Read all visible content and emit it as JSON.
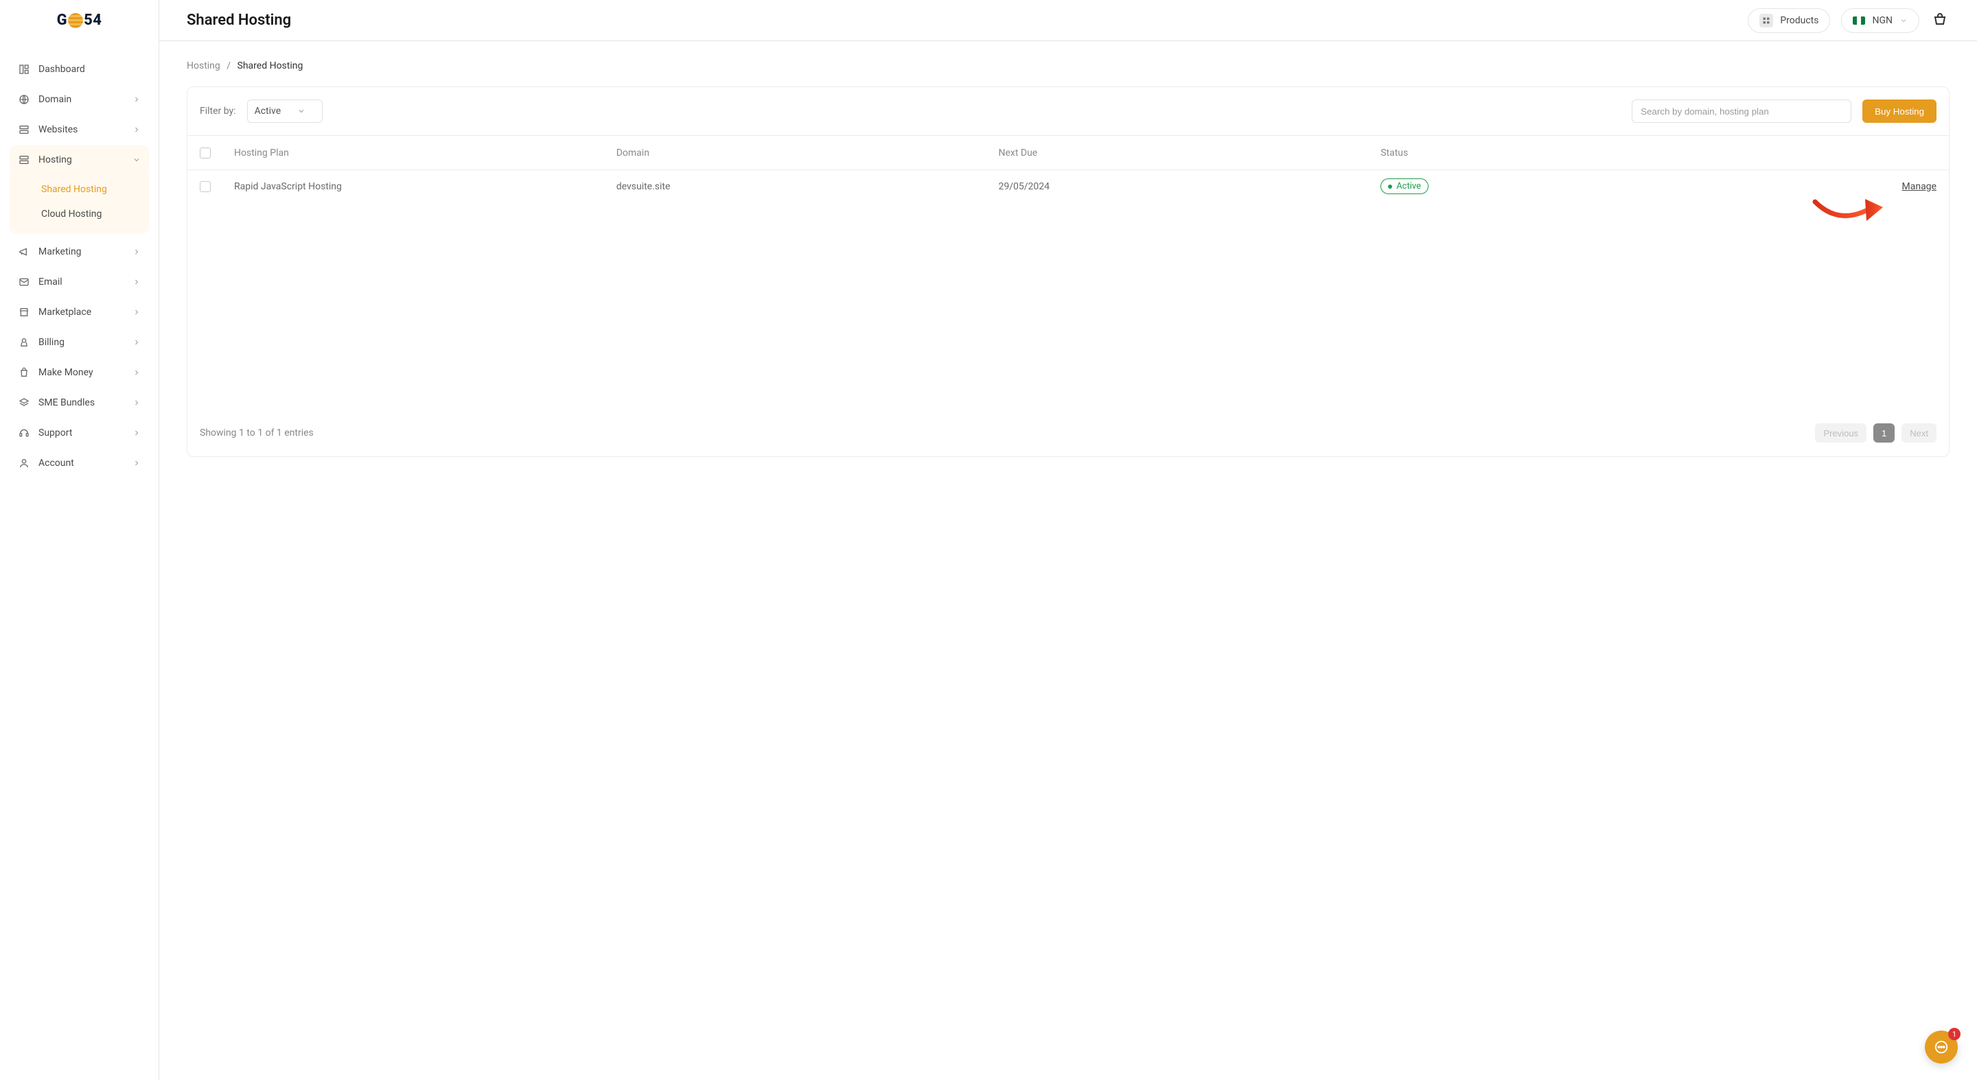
{
  "brand": {
    "prefix": "G",
    "suffix": "54"
  },
  "header": {
    "page_title": "Shared Hosting",
    "products_label": "Products",
    "currency_label": "NGN"
  },
  "sidebar": {
    "items": [
      {
        "label": "Dashboard",
        "icon": "dashboard-icon",
        "expandable": false
      },
      {
        "label": "Domain",
        "icon": "globe-icon",
        "expandable": true
      },
      {
        "label": "Websites",
        "icon": "server-icon",
        "expandable": true
      },
      {
        "label": "Hosting",
        "icon": "server-icon",
        "expandable": true,
        "expanded": true,
        "children": [
          {
            "label": "Shared Hosting",
            "active": true
          },
          {
            "label": "Cloud Hosting",
            "active": false
          }
        ]
      },
      {
        "label": "Marketing",
        "icon": "megaphone-icon",
        "expandable": true
      },
      {
        "label": "Email",
        "icon": "mail-icon",
        "expandable": true
      },
      {
        "label": "Marketplace",
        "icon": "store-icon",
        "expandable": true
      },
      {
        "label": "Billing",
        "icon": "wallet-icon",
        "expandable": true
      },
      {
        "label": "Make Money",
        "icon": "bag-icon",
        "expandable": true
      },
      {
        "label": "SME Bundles",
        "icon": "layers-icon",
        "expandable": true
      },
      {
        "label": "Support",
        "icon": "headset-icon",
        "expandable": true
      },
      {
        "label": "Account",
        "icon": "user-icon",
        "expandable": true
      }
    ]
  },
  "breadcrumb": {
    "parent": "Hosting",
    "separator": "/",
    "current": "Shared Hosting"
  },
  "filter": {
    "label": "Filter by:",
    "selected": "Active"
  },
  "search": {
    "placeholder": "Search by domain, hosting plan"
  },
  "actions": {
    "buy_label": "Buy Hosting"
  },
  "table": {
    "columns": {
      "plan": "Hosting Plan",
      "domain": "Domain",
      "next_due": "Next Due",
      "status": "Status"
    },
    "rows": [
      {
        "plan": "Rapid JavaScript Hosting",
        "domain": "devsuite.site",
        "next_due": "29/05/2024",
        "status": "Active",
        "manage": "Manage"
      }
    ]
  },
  "footer": {
    "showing": "Showing 1 to 1 of 1 entries",
    "prev": "Previous",
    "page": "1",
    "next": "Next"
  },
  "chat": {
    "badge": "1"
  }
}
